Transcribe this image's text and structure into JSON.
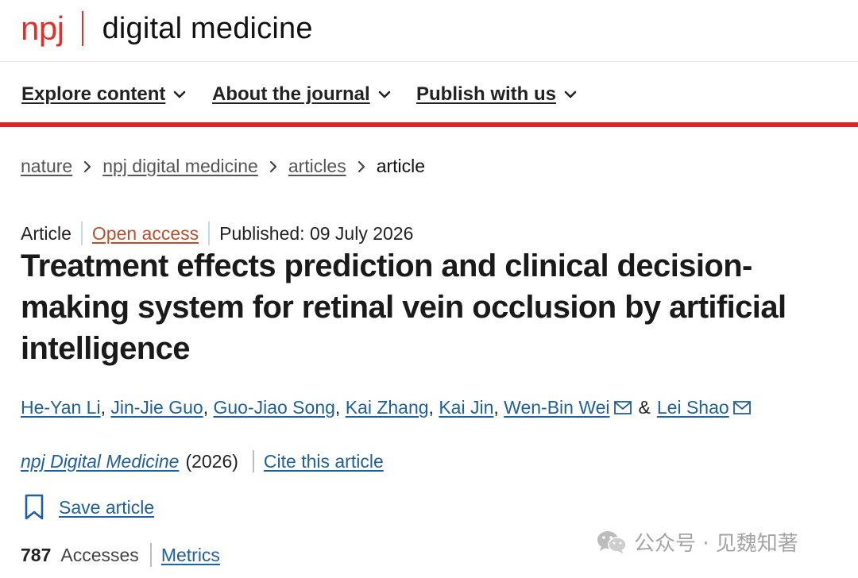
{
  "brand": {
    "npj": "npj",
    "title": "digital medicine",
    "brand_color": "#e0302a"
  },
  "nav": {
    "items": [
      {
        "label": "Explore content"
      },
      {
        "label": "About the journal"
      },
      {
        "label": "Publish with us"
      }
    ],
    "accent_color": "#d8262b"
  },
  "breadcrumb": {
    "items": [
      "nature",
      "npj digital medicine",
      "articles"
    ],
    "current": "article"
  },
  "meta": {
    "type": "Article",
    "access": "Open access",
    "published": "Published: 09 July 2026"
  },
  "article": {
    "title": "Treatment effects prediction and clinical decision-making system for retinal vein occlusion by artificial intelligence"
  },
  "authors": {
    "list": [
      "He-Yan Li",
      "Jin-Jie Guo",
      "Guo-Jiao Song",
      "Kai Zhang",
      "Kai Jin",
      "Wen-Bin Wei",
      "Lei Shao"
    ],
    "separator": ",",
    "ampersand": "&"
  },
  "journal": {
    "name": "npj Digital Medicine",
    "year": "(2026)",
    "cite_label": "Cite this article"
  },
  "actions": {
    "save_label": "Save article"
  },
  "metrics": {
    "count": "787",
    "accesses_label": "Accesses",
    "metrics_label": "Metrics"
  },
  "watermark": {
    "text": "公众号 · 见魏知著"
  },
  "colors": {
    "link": "#1f5f9e",
    "open_access": "#b5522b",
    "text": "#222222"
  }
}
